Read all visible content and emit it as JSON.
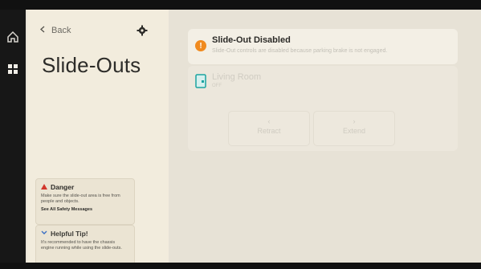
{
  "nav": {
    "back_label": "Back",
    "page_title": "Slide-Outs"
  },
  "banner": {
    "title": "Slide-Out Disabled",
    "subtitle": "Slide-Out controls are disabled because parking brake is not engaged."
  },
  "room": {
    "name": "Living Room",
    "state": "OFF"
  },
  "controls": {
    "retract_label": "Retract",
    "extend_label": "Extend"
  },
  "danger_card": {
    "title": "Danger",
    "body": "Make sure the slide-out area is free from people and objects.",
    "link": "See All Safety Messages"
  },
  "tip_card": {
    "title": "Helpful Tip!",
    "body": "It's recommended to have the chassis engine running while using the slide-outs."
  },
  "colors": {
    "warning": "#f08a1e",
    "danger": "#d2372c",
    "tip": "#3b6fc4",
    "accent_room": "#1ba4a0"
  },
  "icons": [
    "home-icon",
    "grid-icon",
    "bell-icon",
    "cube-icon",
    "card-icon",
    "gear-icon",
    "warning-icon",
    "room-icon"
  ]
}
